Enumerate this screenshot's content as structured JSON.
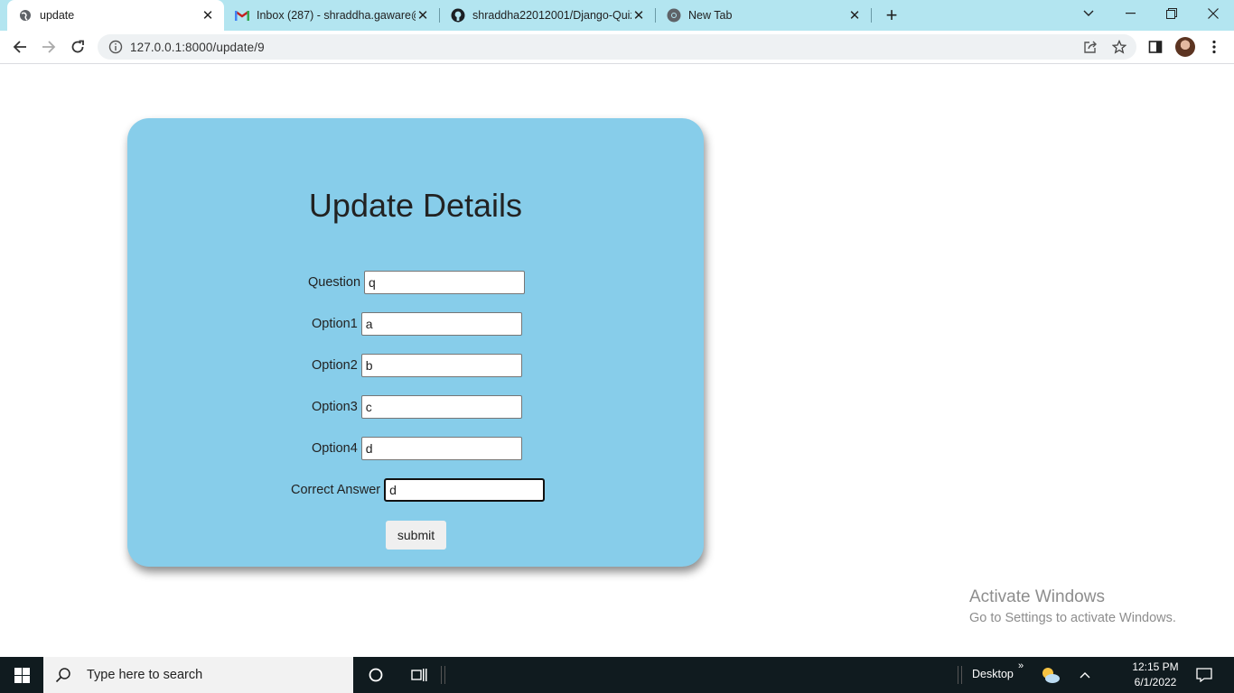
{
  "browser": {
    "tabs": [
      {
        "title": "update",
        "icon": "globe-icon"
      },
      {
        "title": "Inbox (287) - shraddha.gaware@",
        "icon": "gmail-icon"
      },
      {
        "title": "shraddha22012001/Django-Quiz",
        "icon": "github-icon"
      },
      {
        "title": "New Tab",
        "icon": "chrome-icon"
      }
    ],
    "url": "127.0.0.1:8000/update/9"
  },
  "form": {
    "heading": "Update Details",
    "fields": [
      {
        "label": "Question",
        "value": "q"
      },
      {
        "label": "Option1",
        "value": "a"
      },
      {
        "label": "Option2",
        "value": "b"
      },
      {
        "label": "Option3",
        "value": "c"
      },
      {
        "label": "Option4",
        "value": "d"
      },
      {
        "label": "Correct Answer",
        "value": "d"
      }
    ],
    "submit_label": "submit",
    "card_color": "#87cdea"
  },
  "watermark": {
    "line1": "Activate Windows",
    "line2": "Go to Settings to activate Windows."
  },
  "taskbar": {
    "search_placeholder": "Type here to search",
    "desktop_label": "Desktop",
    "time": "12:15 PM",
    "date": "6/1/2022"
  }
}
